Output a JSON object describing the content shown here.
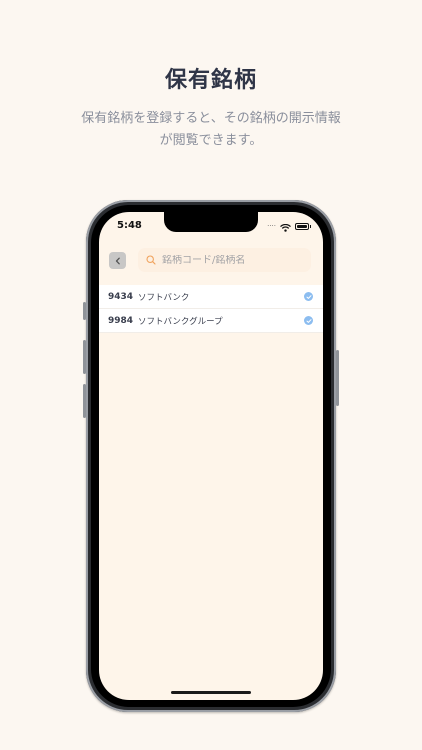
{
  "header": {
    "title": "保有銘柄",
    "description_line1": "保有銘柄を登録すると、その銘柄の開示情報",
    "description_line2": "が閲覧できます。"
  },
  "status_bar": {
    "time": "5:48",
    "icons": [
      "signal-dots-icon",
      "wifi-icon",
      "battery-icon"
    ]
  },
  "search": {
    "placeholder": "銘柄コード/銘柄名",
    "value": "",
    "icon": "search-icon"
  },
  "back_button": {
    "icon": "chevron-left-icon"
  },
  "stocks": [
    {
      "code": "9434",
      "name": "ソフトバンク",
      "selected": true
    },
    {
      "code": "9984",
      "name": "ソフトバンクグループ",
      "selected": true
    }
  ],
  "colors": {
    "page_background": "#fcf7f1",
    "screen_background": "#fef5ea",
    "search_icon": "#f0a35e",
    "check_accent": "#8cbdf0"
  }
}
